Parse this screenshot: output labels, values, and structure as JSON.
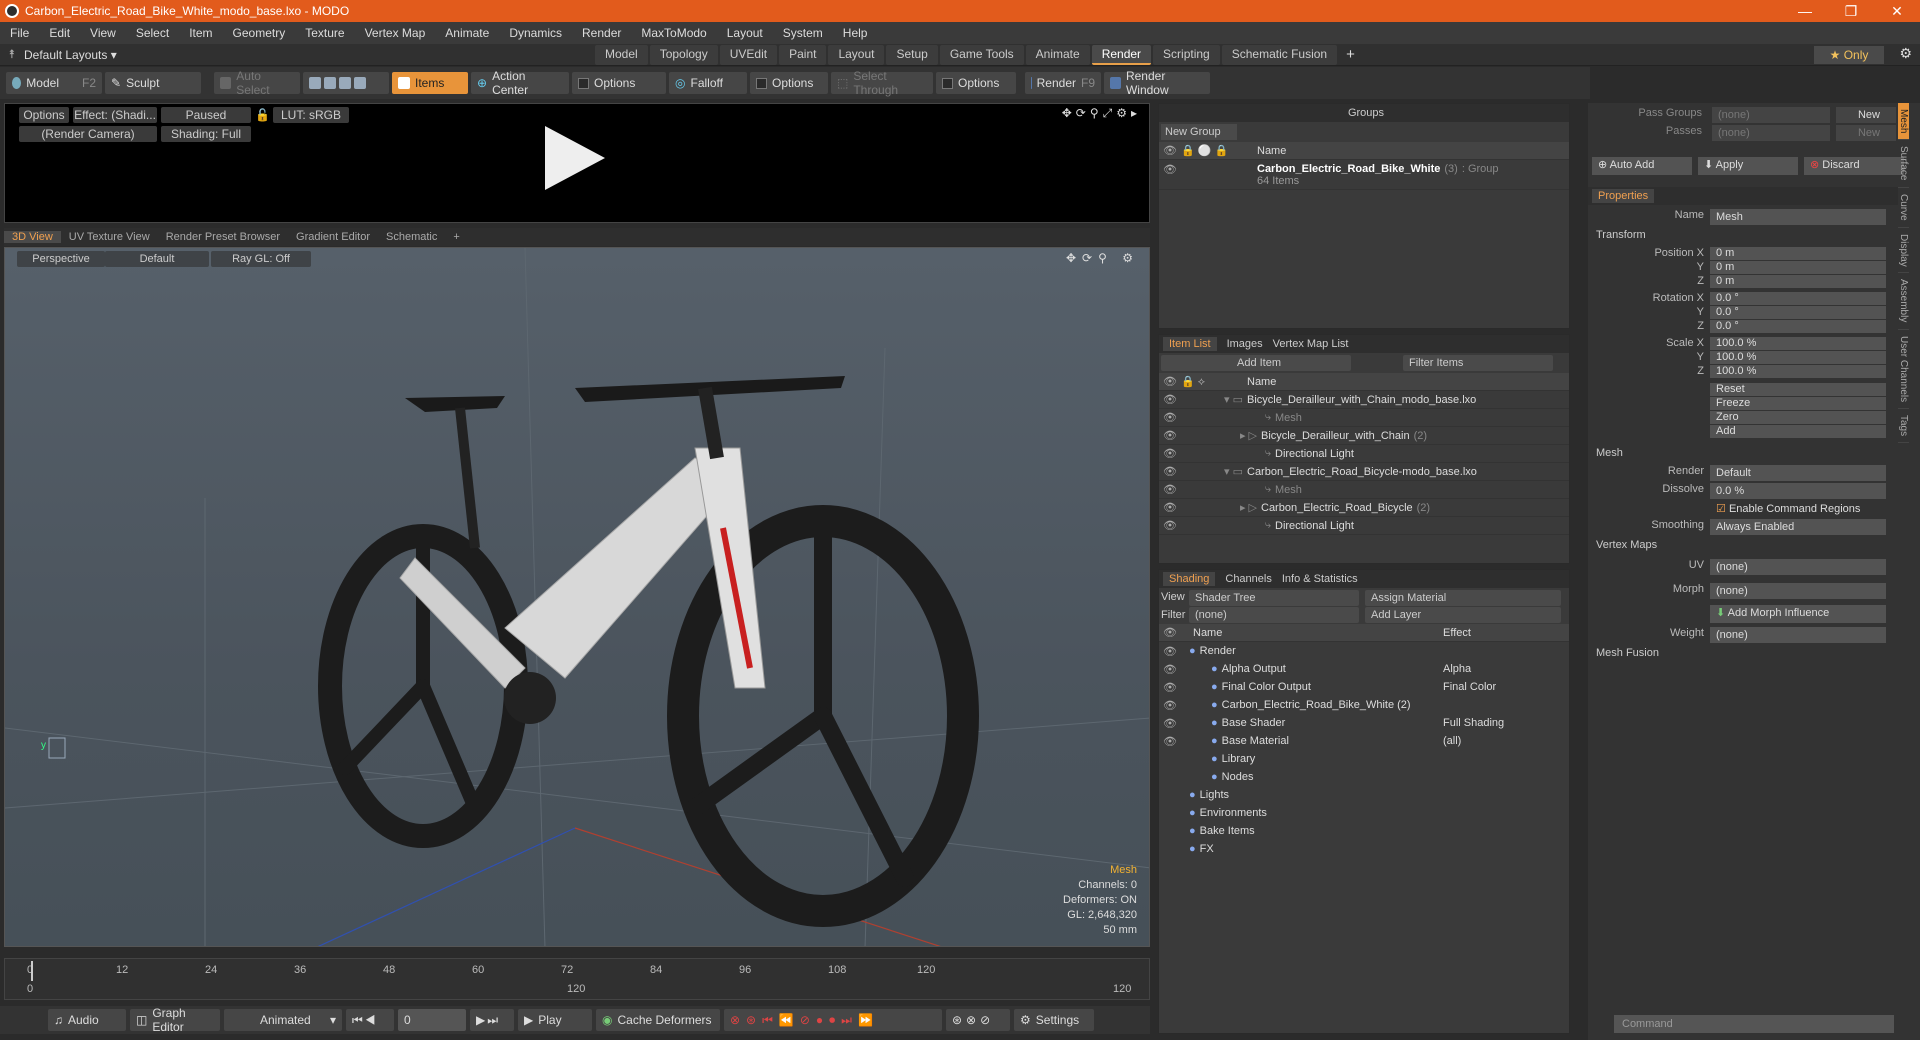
{
  "title": "Carbon_Electric_Road_Bike_White_modo_base.lxo - MODO",
  "menu": [
    "File",
    "Edit",
    "View",
    "Select",
    "Item",
    "Geometry",
    "Texture",
    "Vertex Map",
    "Animate",
    "Dynamics",
    "Render",
    "MaxToModo",
    "Layout",
    "System",
    "Help"
  ],
  "layouts": "Default Layouts ▾",
  "layout_tabs": [
    "Model",
    "Topology",
    "UVEdit",
    "Paint",
    "Layout",
    "Setup",
    "Game Tools",
    "Animate",
    "Render",
    "Scripting",
    "Schematic Fusion"
  ],
  "only": "★ Only",
  "toolbar": {
    "model": "Model",
    "model_key": "F2",
    "sculpt": "Sculpt",
    "auto_select": "Auto Select",
    "items": "Items",
    "action_center": "Action Center",
    "options": "Options",
    "falloff": "Falloff",
    "select_through": "Select Through",
    "render": "Render",
    "render_key": "F9",
    "render_window": "Render Window"
  },
  "preview": {
    "options": "Options",
    "effect": "Effect: (Shadi...",
    "paused": "Paused",
    "lut": "LUT: sRGB",
    "camera": "(Render Camera)",
    "shading": "Shading: Full"
  },
  "vp_tabs": [
    "3D View",
    "UV Texture View",
    "Render Preset Browser",
    "Gradient Editor",
    "Schematic"
  ],
  "vp": {
    "perspective": "Perspective",
    "default": "Default",
    "raygl": "Ray GL: Off",
    "mesh": "Mesh",
    "channels": "Channels: 0",
    "deformers": "Deformers: ON",
    "gl": "GL: 2,648,320",
    "size": "50 mm"
  },
  "timeline": {
    "ticks": [
      "0",
      "12",
      "24",
      "36",
      "48",
      "60",
      "72",
      "84",
      "96",
      "108",
      "120"
    ],
    "start": "0",
    "end": "120",
    "mid": "120"
  },
  "bottom": {
    "audio": "Audio",
    "graph": "Graph Editor",
    "animated": "Animated",
    "frame": "0",
    "play": "Play",
    "cache": "Cache Deformers",
    "settings": "Settings"
  },
  "groups": {
    "header": "Groups",
    "new_group": "New Group",
    "col_name": "Name",
    "item": "Carbon_Electric_Road_Bike_White",
    "item_count": "(3)",
    "item_type": ": Group",
    "items": "64 Items"
  },
  "itemlist": {
    "tabs": [
      "Item List",
      "Images",
      "Vertex Map List"
    ],
    "add_item": "Add Item",
    "filter": "Filter Items",
    "col_name": "Name",
    "rows": [
      {
        "name": "Bicycle_Derailleur_with_Chain_modo_base.lxo",
        "cnt": "",
        "indent": 0
      },
      {
        "name": "Mesh",
        "cnt": "",
        "indent": 2
      },
      {
        "name": "Bicycle_Derailleur_with_Chain",
        "cnt": "(2)",
        "indent": 1
      },
      {
        "name": "Directional Light",
        "cnt": "",
        "indent": 2
      },
      {
        "name": "Carbon_Electric_Road_Bicycle-modo_base.lxo",
        "cnt": "",
        "indent": 0
      },
      {
        "name": "Mesh",
        "cnt": "",
        "indent": 2
      },
      {
        "name": "Carbon_Electric_Road_Bicycle",
        "cnt": "(2)",
        "indent": 1
      },
      {
        "name": "Directional Light",
        "cnt": "",
        "indent": 2
      }
    ]
  },
  "shading": {
    "tabs": [
      "Shading",
      "Channels",
      "Info & Statistics"
    ],
    "view_label": "View",
    "view": "Shader Tree",
    "assign": "Assign Material",
    "filter_label": "Filter",
    "filter": "(none)",
    "add_layer": "Add Layer",
    "col_name": "Name",
    "col_effect": "Effect",
    "rows": [
      {
        "name": "Render",
        "effect": "",
        "indent": 0
      },
      {
        "name": "Alpha Output",
        "effect": "Alpha",
        "indent": 1
      },
      {
        "name": "Final Color Output",
        "effect": "Final Color",
        "indent": 1
      },
      {
        "name": "Carbon_Electric_Road_Bike_White (2)",
        "effect": "",
        "indent": 1
      },
      {
        "name": "Base Shader",
        "effect": "Full Shading",
        "indent": 1
      },
      {
        "name": "Base Material",
        "effect": "(all)",
        "indent": 1
      },
      {
        "name": "Library",
        "effect": "",
        "indent": 1
      },
      {
        "name": "Nodes",
        "effect": "",
        "indent": 1
      },
      {
        "name": "Lights",
        "effect": "",
        "indent": 0
      },
      {
        "name": "Environments",
        "effect": "",
        "indent": 0
      },
      {
        "name": "Bake Items",
        "effect": "",
        "indent": 0
      },
      {
        "name": "FX",
        "effect": "",
        "indent": 0
      }
    ]
  },
  "passes": {
    "pass_groups": "Pass Groups",
    "passes": "Passes",
    "none": "(none)",
    "new": "New",
    "auto_add": "Auto Add",
    "apply": "Apply",
    "discard": "Discard"
  },
  "props": {
    "tab": "Properties",
    "name_label": "Name",
    "name": "Mesh",
    "transform": "Transform",
    "position": [
      "0 m",
      "0 m",
      "0 m"
    ],
    "rotation": [
      "0.0 °",
      "0.0 °",
      "0.0 °"
    ],
    "scale": [
      "100.0 %",
      "100.0 %",
      "100.0 %"
    ],
    "pos_label": "Position X",
    "rot_label": "Rotation X",
    "scale_label": "Scale X",
    "actions": [
      "Reset",
      "Freeze",
      "Zero",
      "Add"
    ],
    "mesh": "Mesh",
    "render_label": "Render",
    "render": "Default",
    "dissolve_label": "Dissolve",
    "dissolve": "0.0 %",
    "ecr": "Enable Command Regions",
    "smoothing_label": "Smoothing",
    "smoothing": "Always Enabled",
    "vmaps": "Vertex Maps",
    "uv_label": "UV",
    "uv": "(none)",
    "morph_label": "Morph",
    "morph": "(none)",
    "add_morph": "Add Morph Influence",
    "weight_label": "Weight",
    "weight": "(none)",
    "fusion": "Mesh Fusion",
    "command": "Command"
  },
  "sidetabs": [
    "Mesh",
    "Surface",
    "Curve",
    "Display",
    "Assembly",
    "User Channels",
    "Tags"
  ]
}
